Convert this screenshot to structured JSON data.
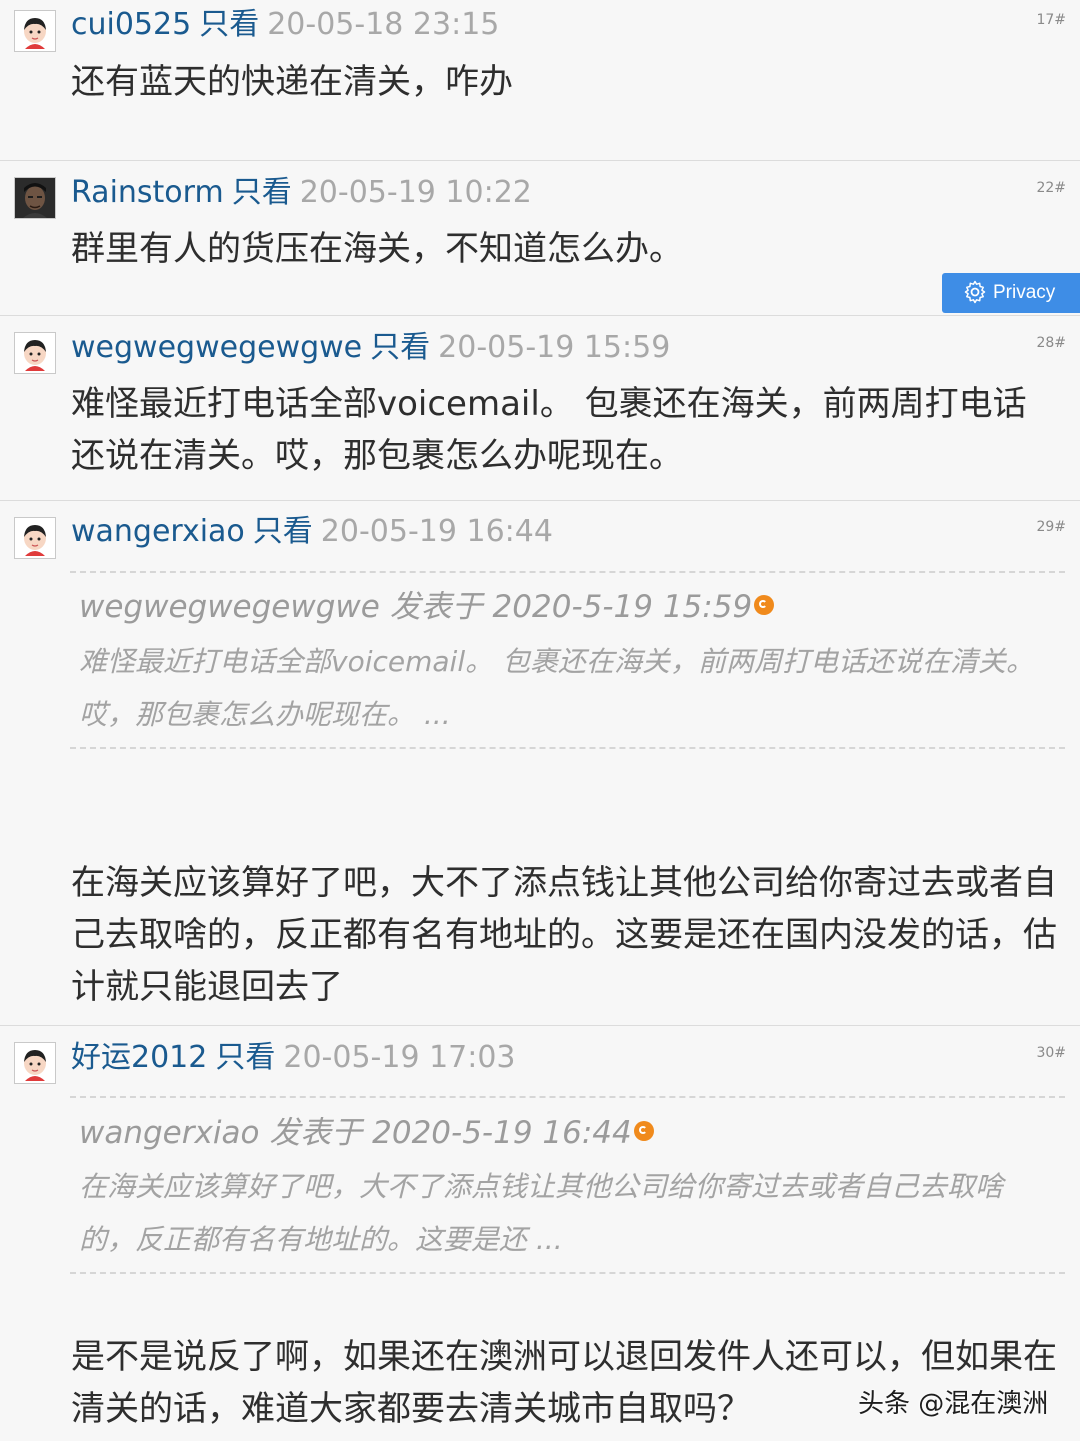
{
  "posts": [
    {
      "username": "cui0525",
      "only_view": "只看",
      "timestamp": "20-05-18 23:15",
      "floor": "17#",
      "content": "还有蓝天的快递在清关，咋办"
    },
    {
      "username": "Rainstorm",
      "only_view": "只看",
      "timestamp": "20-05-19 10:22",
      "floor": "22#",
      "content": "群里有人的货压在海关，不知道怎么办。"
    },
    {
      "username": "wegwegwegewgwe",
      "only_view": "只看",
      "timestamp": "20-05-19 15:59",
      "floor": "28#",
      "content": "难怪最近打电话全部voicemail。 包裹还在海关，前两周打电话还说在清关。哎，那包裹怎么办呢现在。"
    },
    {
      "username": "wangerxiao",
      "only_view": "只看",
      "timestamp": "20-05-19 16:44",
      "floor": "29#",
      "quote": {
        "header": "wegwegwegewgwe 发表于 2020-5-19 15:59",
        "body": "难怪最近打电话全部voicemail。 包裹还在海关，前两周打电话还说在清关。哎，那包裹怎么办呢现在。 ..."
      },
      "content": "在海关应该算好了吧，大不了添点钱让其他公司给你寄过去或者自己去取啥的，反正都有名有地址的。这要是还在国内没发的话，估计就只能退回去了"
    },
    {
      "username": "好运2012",
      "only_view": "只看",
      "timestamp": "20-05-19 17:03",
      "floor": "30#",
      "quote": {
        "header": "wangerxiao 发表于 2020-5-19 16:44",
        "body": "在海关应该算好了吧，大不了添点钱让其他公司给你寄过去或者自己去取啥的，反正都有名有地址的。这要是还 ..."
      },
      "content": "是不是说反了啊，如果还在澳洲可以退回发件人还可以，但如果在清关的话，难道大家都要去清关城市自取吗？"
    }
  ],
  "privacy_button": {
    "label": "Privacy",
    "icon": "gear-icon"
  },
  "watermark": "头条 @混在澳洲",
  "colors": {
    "username": "#1a5a8f",
    "timestamp": "#a8a8a8",
    "privacy_bg": "#3e8de6",
    "quote_icon": "#f08a1c"
  }
}
